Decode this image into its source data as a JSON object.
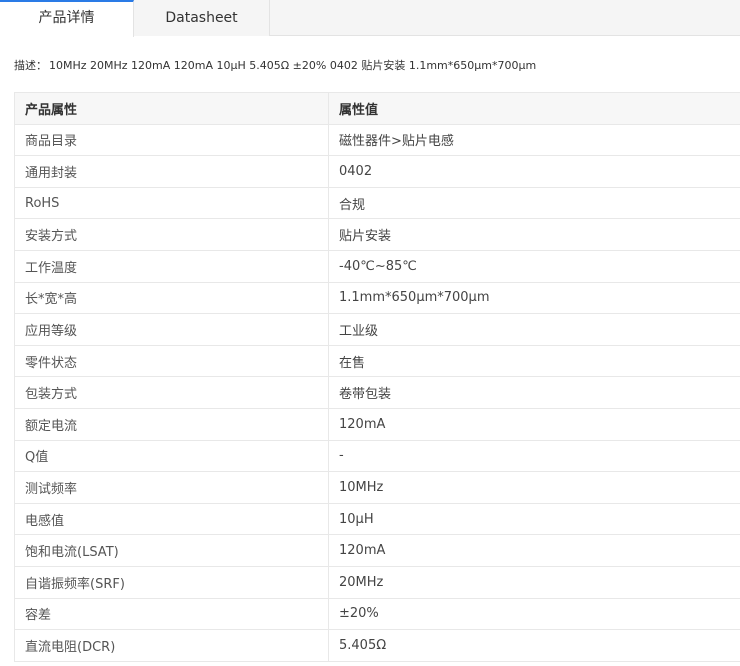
{
  "tabs": [
    {
      "label": "产品详情",
      "active": true
    },
    {
      "label": "Datasheet",
      "active": false
    }
  ],
  "description": {
    "label": "描述：",
    "text": "10MHz 20MHz 120mA 120mA 10μH 5.405Ω ±20% 0402 贴片安装 1.1mm*650μm*700μm"
  },
  "table": {
    "headers": [
      "产品属性",
      "属性值"
    ],
    "rows": [
      [
        "商品目录",
        "磁性器件>贴片电感"
      ],
      [
        "通用封装",
        "0402"
      ],
      [
        "RoHS",
        "合规"
      ],
      [
        "安装方式",
        "贴片安装"
      ],
      [
        "工作温度",
        "-40℃~85℃"
      ],
      [
        "长*宽*高",
        "1.1mm*650μm*700μm"
      ],
      [
        "应用等级",
        "工业级"
      ],
      [
        "零件状态",
        "在售"
      ],
      [
        "包装方式",
        "卷带包装"
      ],
      [
        "额定电流",
        "120mA"
      ],
      [
        "Q值",
        "-"
      ],
      [
        "测试频率",
        "10MHz"
      ],
      [
        "电感值",
        "10μH"
      ],
      [
        "饱和电流(LSAT)",
        "120mA"
      ],
      [
        "自谐振频率(SRF)",
        "20MHz"
      ],
      [
        "容差",
        "±20%"
      ],
      [
        "直流电阻(DCR)",
        "5.405Ω"
      ]
    ]
  },
  "colors": {
    "accent": "#2a7be6",
    "tab_bg": "#f5f5f5",
    "header_bg": "#f7f7f7",
    "border": "#e8e8e8"
  }
}
